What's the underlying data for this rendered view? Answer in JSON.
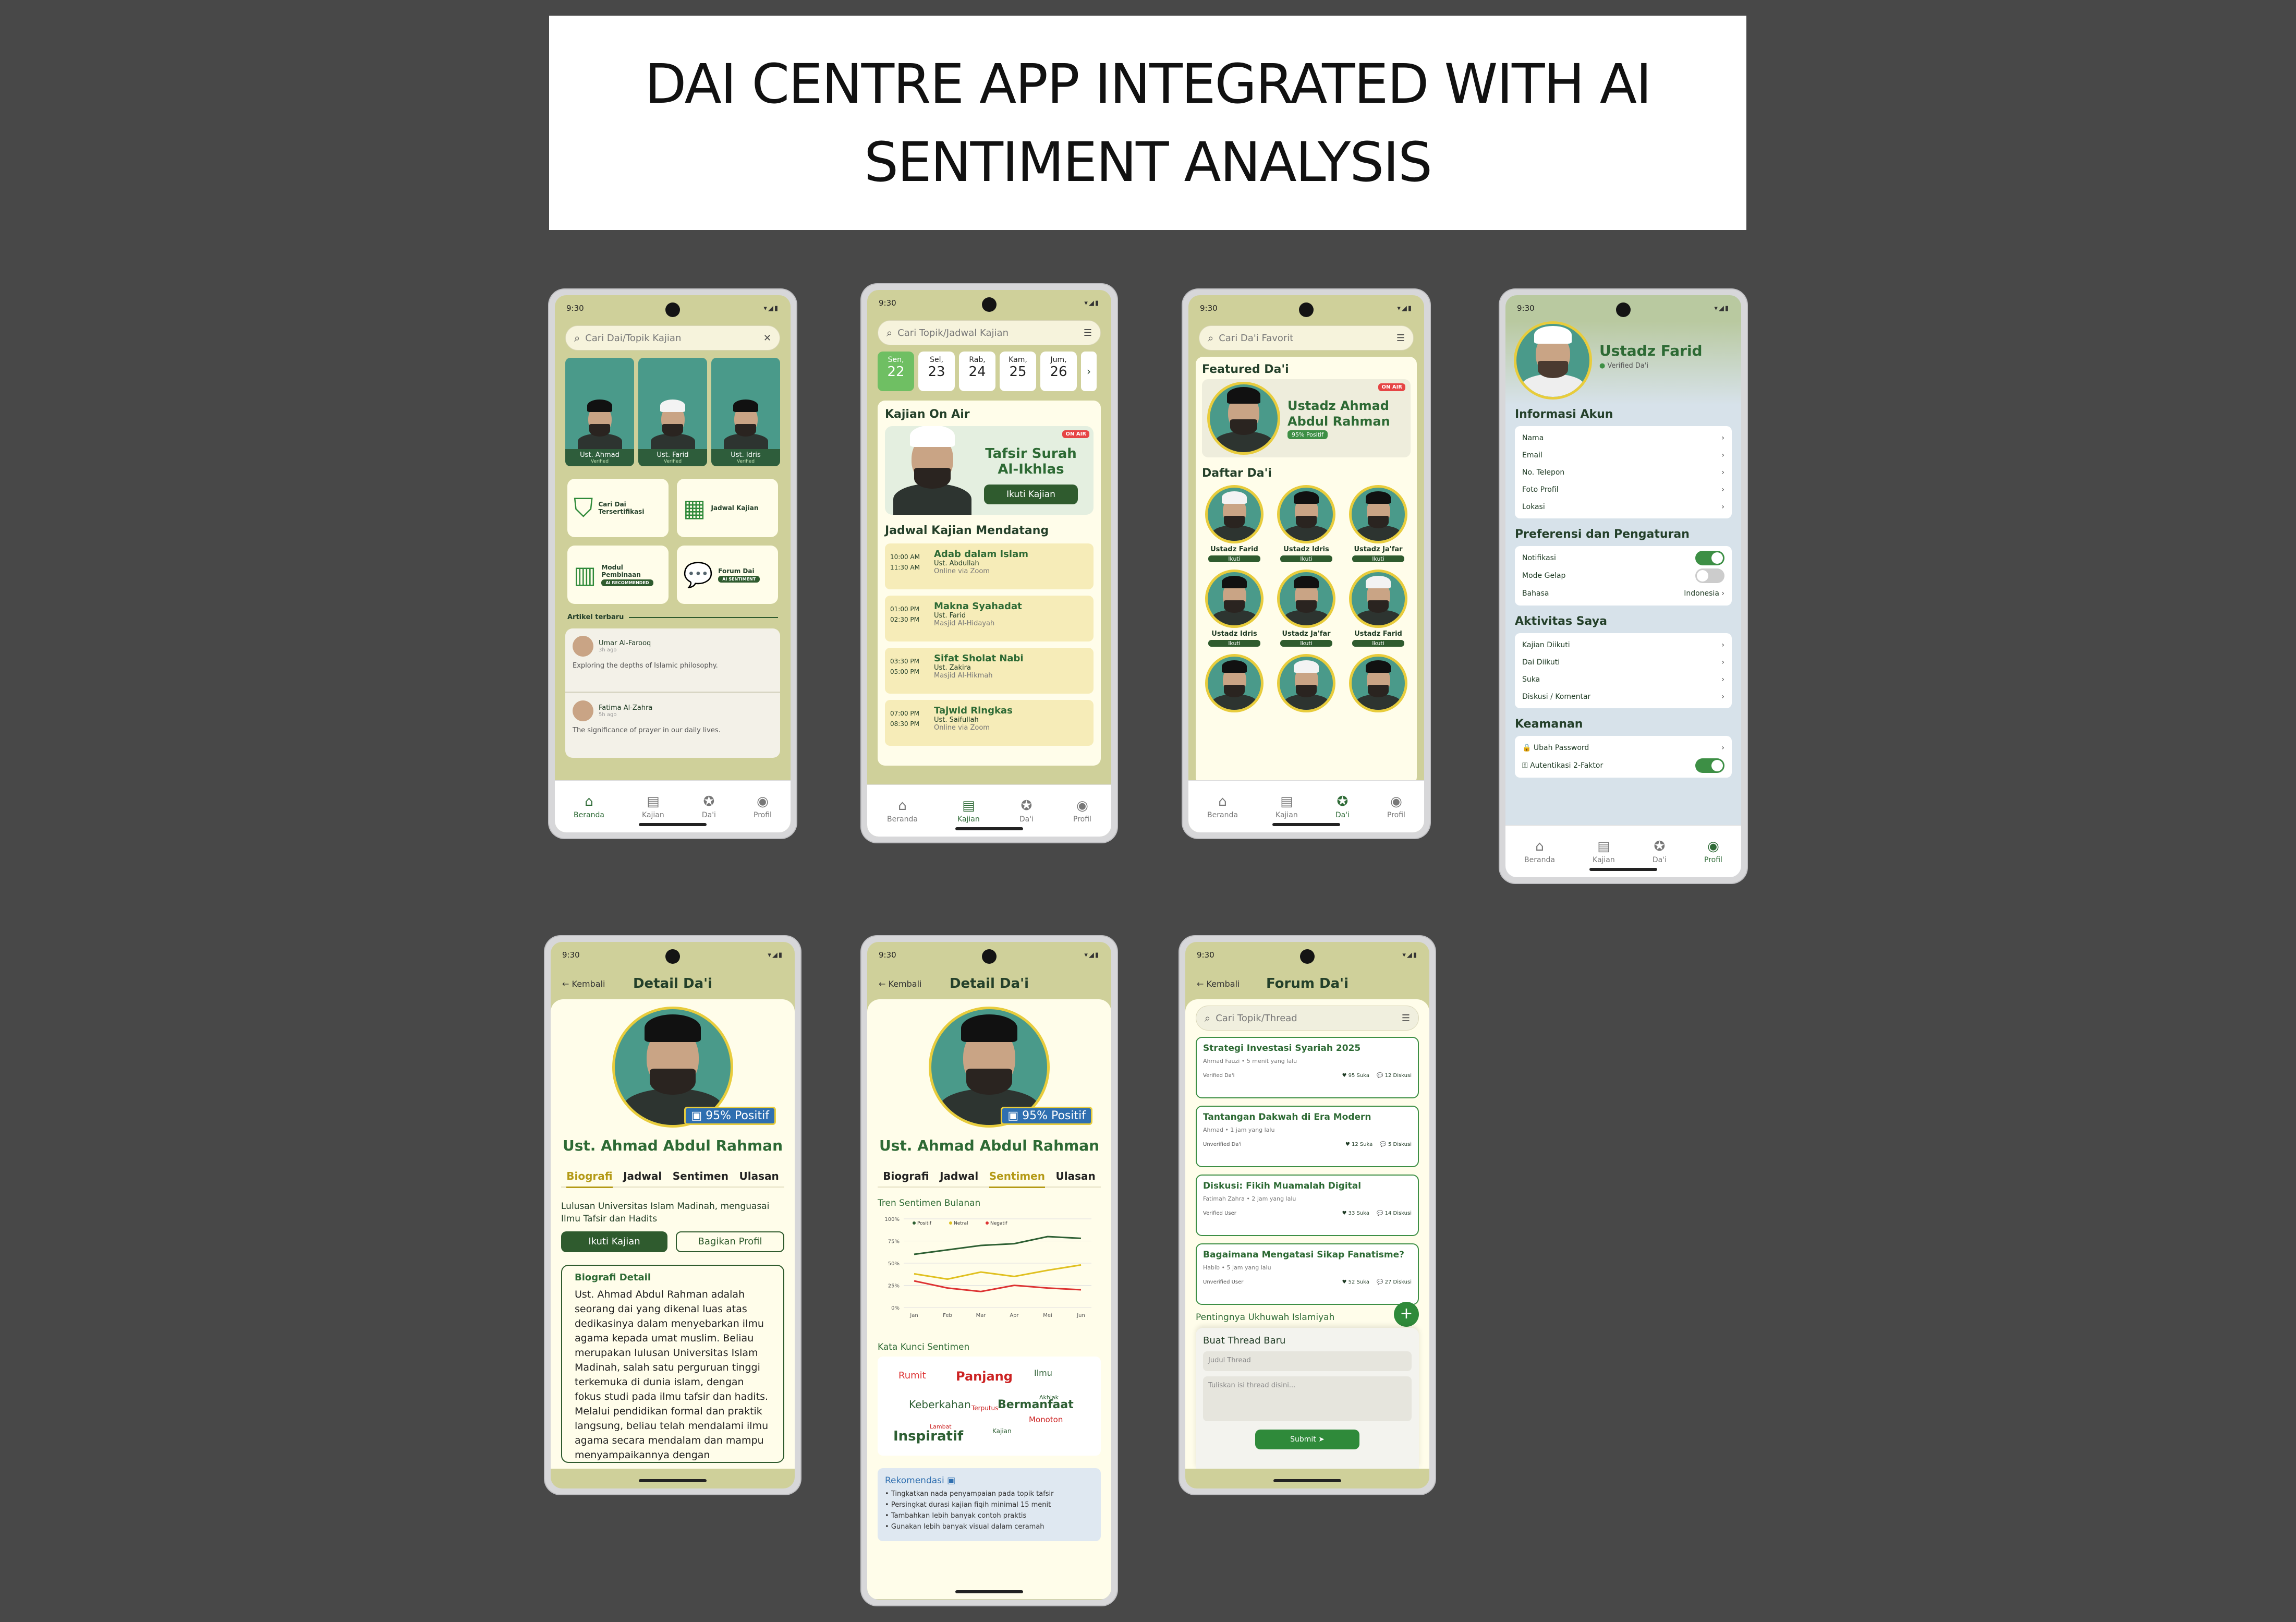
{
  "title": {
    "line1": "DAI CENTRE APP INTEGRATED WITH AI",
    "line2": "SENTIMENT ANALYSIS"
  },
  "status_time": "9:30",
  "nav": {
    "beranda": "Beranda",
    "kajian": "Kajian",
    "dai": "Da'i",
    "profil": "Profil"
  },
  "home": {
    "search_placeholder": "Cari Dai/Topik Kajian",
    "dais": [
      {
        "name": "Ust. Ahmad",
        "tag": "Verified"
      },
      {
        "name": "Ust. Farid",
        "tag": "Verified"
      },
      {
        "name": "Ust. Idris",
        "tag": "Verified"
      }
    ],
    "menu": [
      {
        "label": "Cari Dai Tersertifikasi"
      },
      {
        "label": "Jadwal Kajian"
      },
      {
        "label": "Modul Pembinaan",
        "tag": "AI RECOMMENDED"
      },
      {
        "label": "Forum Dai",
        "tag": "AI SENTIMENT"
      }
    ],
    "articles_title": "Artikel terbaru",
    "articles": [
      {
        "author": "Umar Al-Farooq",
        "time": "3h ago",
        "text": "Exploring the depths of Islamic philosophy."
      },
      {
        "author": "Fatima Al-Zahra",
        "time": "5h ago",
        "text": "The significance of prayer in our daily lives."
      }
    ]
  },
  "kajian": {
    "search_placeholder": "Cari Topik/Jadwal Kajian",
    "days": [
      {
        "d": "Sen,",
        "n": "22"
      },
      {
        "d": "Sel,",
        "n": "23"
      },
      {
        "d": "Rab,",
        "n": "24"
      },
      {
        "d": "Kam,",
        "n": "25"
      },
      {
        "d": "Jum,",
        "n": "26"
      }
    ],
    "on_air_title": "Kajian On Air",
    "on_air_badge": "ON AIR",
    "on_air_topic": "Tafsir Surah Al-Ikhlas",
    "on_air_button": "Ikuti Kajian",
    "upcoming_title": "Jadwal Kajian Mendatang",
    "items": [
      {
        "start": "10:00 AM",
        "end": "11:30 AM",
        "title": "Adab dalam Islam",
        "ust": "Ust. Abdullah",
        "place": "Online via Zoom"
      },
      {
        "start": "01:00 PM",
        "end": "02:30 PM",
        "title": "Makna Syahadat",
        "ust": "Ust. Farid",
        "place": "Masjid Al-Hidayah"
      },
      {
        "start": "03:30 PM",
        "end": "05:00 PM",
        "title": "Sifat Sholat Nabi",
        "ust": "Ust. Zakira",
        "place": "Masjid Al-Hikmah"
      },
      {
        "start": "07:00 PM",
        "end": "08:30 PM",
        "title": "Tajwid Ringkas",
        "ust": "Ust. Saifullah",
        "place": "Online via Zoom"
      }
    ]
  },
  "daiList": {
    "search_placeholder": "Cari Da'i Favorit",
    "featured_title": "Featured Da'i",
    "featured_name": "Ustadz Ahmad Abdul Rahman",
    "featured_badge": "95% Positif",
    "on_air": "ON AIR",
    "list_title": "Daftar Da'i",
    "grid": [
      {
        "name": "Ustadz Farid",
        "btn": "Ikuti"
      },
      {
        "name": "Ustadz Idris",
        "btn": "Ikuti"
      },
      {
        "name": "Ustadz Ja'far",
        "btn": "Ikuti"
      },
      {
        "name": "Ustadz Idris",
        "btn": "Ikuti"
      },
      {
        "name": "Ustadz Ja'far",
        "btn": "Ikuti"
      },
      {
        "name": "Ustadz Farid",
        "btn": "Ikuti"
      }
    ]
  },
  "profile": {
    "name": "Ustadz Farid",
    "verified": "Verified Da'i",
    "akun_title": "Informasi Akun",
    "akun": [
      "Nama",
      "Email",
      "No. Telepon",
      "Foto Profil",
      "Lokasi"
    ],
    "pref_title": "Preferensi dan Pengaturan",
    "notif": "Notifikasi",
    "dark": "Mode Gelap",
    "lang_label": "Bahasa",
    "lang_value": "Indonesia",
    "act_title": "Aktivitas Saya",
    "act": [
      "Kajian Diikuti",
      "Dai Diikuti",
      "Suka",
      "Diskusi / Komentar"
    ],
    "sec_title": "Keamanan",
    "pw": "Ubah Password",
    "twofa": "Autentikasi 2-Faktor"
  },
  "detail": {
    "back": "Kembali",
    "title": "Detail Da'i",
    "badge": "95% Positif",
    "name": "Ust. Ahmad Abdul Rahman",
    "tabs": [
      "Biografi",
      "Jadwal",
      "Sentimen",
      "Ulasan"
    ],
    "bio_short": "Lulusan Universitas Islam Madinah, menguasai Ilmu Tafsir dan Hadits",
    "follow": "Ikuti Kajian",
    "share": "Bagikan Profil",
    "bio_title": "Biografi Detail",
    "bio_text": "Ust. Ahmad Abdul Rahman adalah seorang dai yang dikenal luas atas dedikasinya dalam menyebarkan ilmu agama kepada umat muslim. Beliau merupakan lulusan Universitas Islam Madinah, salah satu perguruan tinggi terkemuka di dunia islam, dengan fokus studi pada ilmu tafsir dan hadits. Melalui pendidikan formal dan praktik langsung, beliau telah mendalami ilmu agama secara mendalam dan mampu menyampaikannya dengan"
  },
  "sentimen": {
    "chart_title": "Tren Sentimen Bulanan",
    "keywords_title": "Kata Kunci Sentimen",
    "keywords": [
      {
        "w": "Rumit",
        "c": "#d33"
      },
      {
        "w": "Panjang",
        "c": "#c22"
      },
      {
        "w": "Ilmu",
        "c": "#2d5f33"
      },
      {
        "w": "Keberkahan",
        "c": "#2d5f33"
      },
      {
        "w": "Terputus",
        "c": "#c22"
      },
      {
        "w": "Bermanfaat",
        "c": "#2d5f33"
      },
      {
        "w": "Akhlak",
        "c": "#2d5f33"
      },
      {
        "w": "Lambat",
        "c": "#c22"
      },
      {
        "w": "Monoton",
        "c": "#c22"
      },
      {
        "w": "Inspiratif",
        "c": "#2d5f33"
      },
      {
        "w": "Kajian",
        "c": "#2d5f33"
      }
    ],
    "rec_title": "Rekomendasi",
    "recs": [
      "Tingkatkan nada penyampaian pada topik tafsir",
      "Persingkat durasi kajian fiqih minimal 15 menit",
      "Tambahkan lebih banyak contoh praktis",
      "Gunakan lebih banyak visual dalam ceramah"
    ]
  },
  "chart_data": {
    "type": "line",
    "x": [
      "Jan",
      "Feb",
      "Mar",
      "Apr",
      "Mei",
      "Jun"
    ],
    "ylim": [
      0,
      100
    ],
    "yticks": [
      "100%",
      "75%",
      "50%",
      "25%",
      "0%"
    ],
    "series": [
      {
        "name": "Positif",
        "color": "#2d5f33",
        "values": [
          60,
          65,
          70,
          72,
          80,
          78
        ]
      },
      {
        "name": "Netral",
        "color": "#e0c020",
        "values": [
          38,
          32,
          40,
          35,
          42,
          48
        ]
      },
      {
        "name": "Negatif",
        "color": "#d33",
        "values": [
          30,
          22,
          18,
          25,
          22,
          20
        ]
      }
    ]
  },
  "forum": {
    "back": "Kembali",
    "title": "Forum Da'i",
    "search_placeholder": "Cari Topik/Thread",
    "threads": [
      {
        "title": "Strategi Investasi Syariah 2025",
        "meta": "Ahmad Fauzi • 5 menit yang lalu",
        "role": "Verified Da'i",
        "likes": "95 Suka",
        "disc": "12 Diskusi"
      },
      {
        "title": "Tantangan Dakwah di Era Modern",
        "meta": "Ahmad • 1 jam yang lalu",
        "role": "Unverified Da'i",
        "likes": "12 Suka",
        "disc": "5 Diskusi"
      },
      {
        "title": "Diskusi: Fikih Muamalah Digital",
        "meta": "Fatimah Zahra • 2 jam yang lalu",
        "role": "Verified User",
        "likes": "33 Suka",
        "disc": "14 Diskusi"
      },
      {
        "title": "Bagaimana Mengatasi Sikap Fanatisme?",
        "meta": "Habib • 5 jam yang lalu",
        "role": "Unverified User",
        "likes": "52 Suka",
        "disc": "27 Diskusi"
      }
    ],
    "peek": "Pentingnya Ukhuwah Islamiyah",
    "new_title": "Buat Thread Baru",
    "ph_title": "Judul Thread",
    "ph_body": "Tuliskan isi thread disini...",
    "submit": "Submit ➤"
  }
}
